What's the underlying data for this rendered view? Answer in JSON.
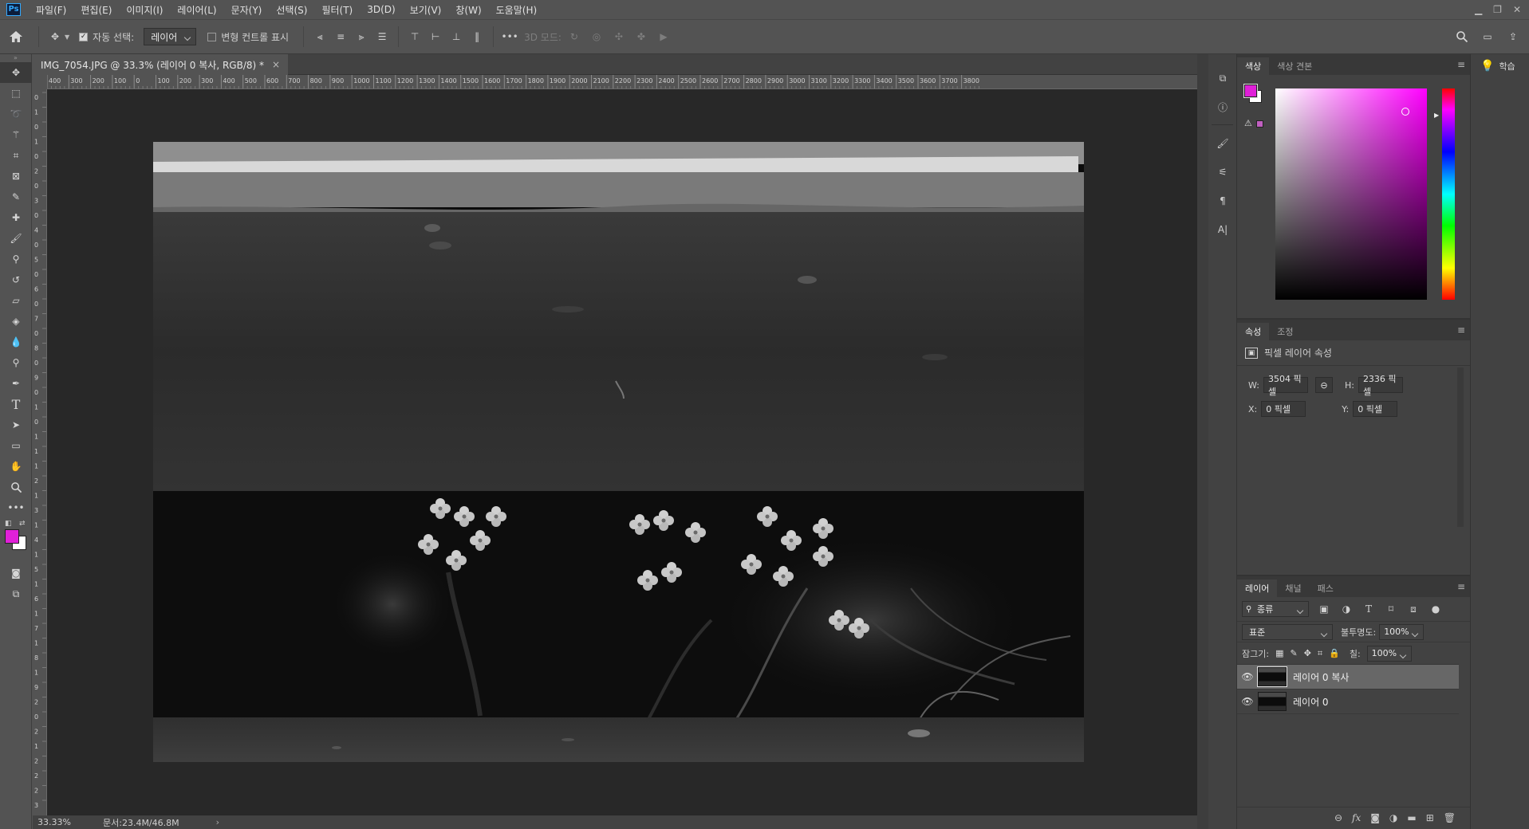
{
  "menubar": {
    "logo": "Ps",
    "items": [
      "파일(F)",
      "편집(E)",
      "이미지(I)",
      "레이어(L)",
      "문자(Y)",
      "선택(S)",
      "필터(T)",
      "3D(D)",
      "보기(V)",
      "창(W)",
      "도움말(H)"
    ]
  },
  "options": {
    "auto_select_label": "자동 선택:",
    "auto_select_target": "레이어",
    "transform_controls_label": "변형 컨트롤 표시",
    "mode_3d_label": "3D 모드:"
  },
  "document": {
    "tab_title": "IMG_7054.JPG @ 33.3% (레이어 0 복사, RGB/8) *",
    "close_symbol": "×",
    "zoom": "33.33%",
    "doc_info": "문서:23.4M/46.8M",
    "ruler_h": [
      "400",
      "300",
      "200",
      "100",
      "0",
      "100",
      "200",
      "300",
      "400",
      "500",
      "600",
      "700",
      "800",
      "900",
      "1000",
      "1100",
      "1200",
      "1300",
      "1400",
      "1500",
      "1600",
      "1700",
      "1800",
      "1900",
      "2000",
      "2100",
      "2200",
      "2300",
      "2400",
      "2500",
      "2600",
      "2700",
      "2800",
      "2900",
      "3000",
      "3100",
      "3200",
      "3300",
      "3400",
      "3500",
      "3600",
      "3700",
      "3800"
    ],
    "ruler_v": [
      "0",
      "1",
      "0",
      "1",
      "0",
      "2",
      "0",
      "3",
      "0",
      "4",
      "0",
      "5",
      "0",
      "6",
      "0",
      "7",
      "0",
      "8",
      "0",
      "9",
      "0",
      "1",
      "0",
      "1",
      "1",
      "1",
      "2",
      "1",
      "3",
      "1",
      "4",
      "1",
      "5",
      "1",
      "6",
      "1",
      "7",
      "1",
      "8",
      "1",
      "9",
      "2",
      "0",
      "2",
      "1",
      "2",
      "2",
      "2",
      "3"
    ]
  },
  "color_panel": {
    "tabs": [
      "색상",
      "색상 견본"
    ],
    "foreground": "#e020d8",
    "background": "#ffffff",
    "hue_color": "#ff00ff"
  },
  "properties_panel": {
    "tabs": [
      "속성",
      "조정"
    ],
    "title": "픽셀 레이어 속성",
    "w_label": "W:",
    "w_value": "3504 픽셀",
    "h_label": "H:",
    "h_value": "2336 픽셀",
    "x_label": "X:",
    "x_value": "0 픽셀",
    "y_label": "Y:",
    "y_value": "0 픽셀"
  },
  "layers_panel": {
    "tabs": [
      "레이어",
      "채널",
      "패스"
    ],
    "filter_kind": "종류",
    "blend_mode": "표준",
    "opacity_label": "불투명도:",
    "opacity": "100%",
    "lock_label": "잠그기:",
    "fill_label": "칠:",
    "fill": "100%",
    "layers": [
      {
        "name": "레이어 0 복사",
        "selected": true
      },
      {
        "name": "레이어 0",
        "selected": false
      }
    ]
  },
  "learn_panel": {
    "label": "학습"
  }
}
